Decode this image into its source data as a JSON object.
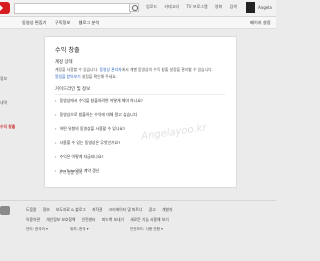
{
  "header": {
    "search_placeholder": "",
    "links": [
      "업로드",
      "카테고리",
      "TV 프로그램",
      "영화",
      "검색"
    ],
    "user": "Angela"
  },
  "nav": {
    "tabs": [
      "동영상 편집기",
      "구독정보",
      "웹로그 분석"
    ],
    "settings": "페이지 설정"
  },
  "sidebar": {
    "items": [
      "",
      "",
      "",
      "",
      "정보",
      "",
      "내역",
      "수익 창출",
      "",
      "",
      "",
      "",
      ""
    ],
    "active_index": 7
  },
  "main": {
    "title": "수익 창출",
    "account_section": "계정 상태",
    "account_text_1": "계정을 사용할 수 있습니다.",
    "account_link_1": "동영상 관리자",
    "account_text_2": "에서 개별 동영상의 수익 창출 설정을 관리할 수 있습니다.",
    "account_link_2": "알림을 받아보기",
    "account_text_3": "설정을 확인해 주세요.",
    "guide_section": "가이드라인 및 정보",
    "faq": [
      "동영상에서 수익을 창출하려면 어떻게 해야 하나요?",
      "동영상으로 창출하는 수익에 대해 알고 싶습니다",
      "어떤 유형의 동영상을 사용할 수 있나요?",
      "사용할 수 있는 동영상은 무엇인가요?",
      "수익은 어떻게 지급되나요?",
      "YouTube와의 계약 갱신"
    ],
    "pager": "수익 창출 중지",
    "watermark": "Angelayoo.kr"
  },
  "footer": {
    "row1": [
      "도움말",
      "정보",
      "보도자료 & 블로그",
      "저작권",
      "크리에이터 및 파트너",
      "광고",
      "개발자"
    ],
    "row2": [
      "이용약관",
      "개인정보 보호정책",
      "안전센터",
      "피드백 보내기",
      "새로운 기능 사용해 보기"
    ],
    "lang_label": "언어:",
    "lang_value": "한국어",
    "loc_label": "위치:",
    "loc_value": "한국",
    "mode_label": "안전모드:",
    "mode_value": "사용 안함"
  }
}
